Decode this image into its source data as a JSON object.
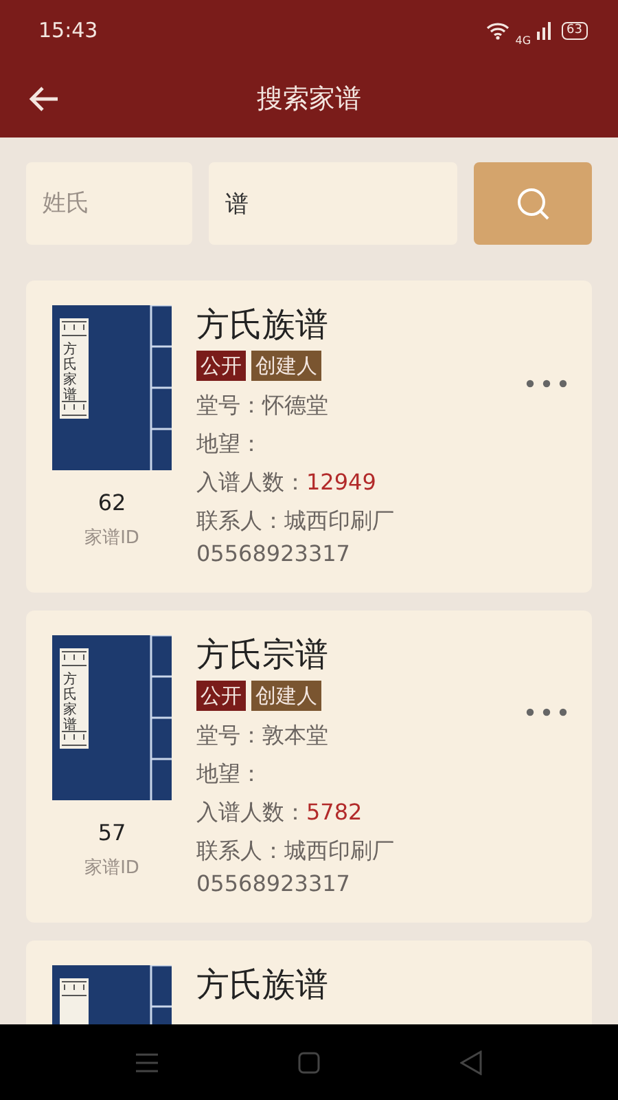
{
  "status_bar": {
    "time": "15:43",
    "network": "4G",
    "battery": "63"
  },
  "header": {
    "title": "搜索家谱"
  },
  "search": {
    "surname": {
      "placeholder": "姓氏"
    },
    "keyword": {
      "value": "谱"
    }
  },
  "results": [
    {
      "cover_label": "方氏家谱",
      "id": "62",
      "id_label": "家谱ID",
      "title": "方氏族谱",
      "tags": [
        {
          "text": "公开",
          "color": "#7a1c1a"
        },
        {
          "text": "创建人",
          "color": "#7a5530"
        }
      ],
      "fields": [
        {
          "kind": "plain",
          "label": "堂号：",
          "value": "怀德堂"
        },
        {
          "kind": "plain",
          "label": "地望："
        },
        {
          "kind": "count",
          "label": "入谱人数：",
          "value": "12949"
        },
        {
          "kind": "plain",
          "label": "联系人：",
          "value": "城西印刷厂"
        }
      ],
      "phone": "05568923317"
    },
    {
      "cover_label": "方氏家谱",
      "id": "57",
      "id_label": "家谱ID",
      "title": "方氏宗谱",
      "tags": [
        {
          "text": "公开",
          "color": "#7a1c1a"
        },
        {
          "text": "创建人",
          "color": "#7a5530"
        }
      ],
      "fields": [
        {
          "kind": "plain",
          "label": "堂号：",
          "value": "敦本堂"
        },
        {
          "kind": "plain",
          "label": "地望："
        },
        {
          "kind": "count",
          "label": "入谱人数：",
          "value": "5782"
        },
        {
          "kind": "plain",
          "label": "联系人：",
          "value": "城西印刷厂"
        }
      ],
      "phone": "05568923317"
    },
    {
      "title": "方氏族谱"
    }
  ]
}
